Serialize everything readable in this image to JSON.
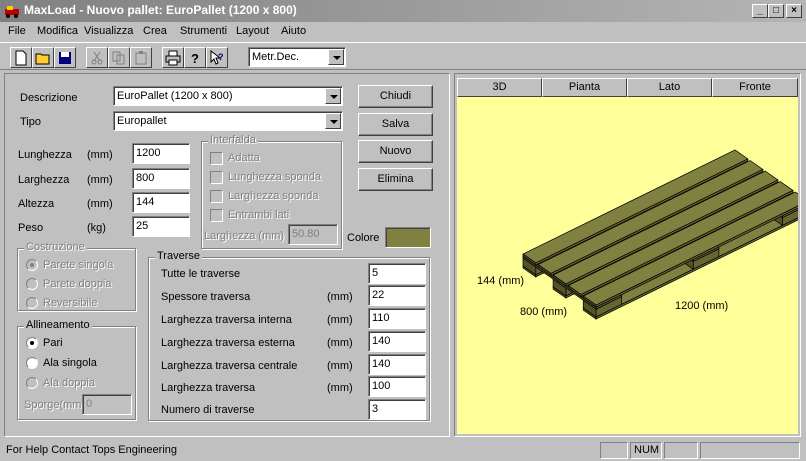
{
  "window": {
    "title": "MaxLoad - Nuovo pallet: EuroPallet (1200 x 800)"
  },
  "menu": [
    "File",
    "Modifica",
    "Visualizza",
    "Crea",
    "Strumenti",
    "Layout",
    "Aiuto"
  ],
  "toolbar": {
    "units": "Metr.Dec."
  },
  "form": {
    "descrizione_label": "Descrizione",
    "descrizione_value": "EuroPallet (1200 x 800)",
    "tipo_label": "Tipo",
    "tipo_value": "Europallet",
    "lunghezza_label": "Lunghezza",
    "lunghezza_unit": "(mm)",
    "lunghezza_value": "1200",
    "larghezza_label": "Larghezza",
    "larghezza_unit": "(mm)",
    "larghezza_value": "800",
    "altezza_label": "Altezza",
    "altezza_unit": "(mm)",
    "altezza_value": "144",
    "peso_label": "Peso",
    "peso_unit": "(kg)",
    "peso_value": "25",
    "colore_label": "Colore",
    "colore_hex": "#808040"
  },
  "buttons": {
    "chiudi": "Chiudi",
    "salva": "Salva",
    "nuovo": "Nuovo",
    "elimina": "Elimina"
  },
  "interfalda": {
    "title": "Interfalda",
    "adatta": "Adatta",
    "lunghezza_sponda": "Lunghezza sponda",
    "larghezza_sponda": "Larghezza sponda",
    "entrambi_lati": "Entrambi lati",
    "larghezza_label": "Larghezza (mm)",
    "larghezza_value": "50.80"
  },
  "costruzione": {
    "title": "Costruzione",
    "parete_singola": "Parete singola",
    "parete_doppia": "Parete doppia",
    "reversibile": "Reversibile"
  },
  "allineamento": {
    "title": "Allineamento",
    "pari": "Pari",
    "ala_singola": "Ala singola",
    "ala_doppia": "Ala doppia",
    "sporge_label": "Sporge(mm)",
    "sporge_value": "0"
  },
  "traverse": {
    "title": "Traverse",
    "rows": [
      {
        "label": "Tutte le traverse",
        "unit": "",
        "value": "5"
      },
      {
        "label": "Spessore traversa",
        "unit": "(mm)",
        "value": "22"
      },
      {
        "label": "Larghezza traversa interna",
        "unit": "(mm)",
        "value": "110"
      },
      {
        "label": "Larghezza traversa esterna",
        "unit": "(mm)",
        "value": "140"
      },
      {
        "label": "Larghezza traversa centrale",
        "unit": "(mm)",
        "value": "140"
      },
      {
        "label": "Larghezza traversa",
        "unit": "(mm)",
        "value": "100"
      },
      {
        "label": "Numero di traverse",
        "unit": "",
        "value": "3"
      }
    ]
  },
  "view_tabs": [
    "3D",
    "Pianta",
    "Lato",
    "Fronte"
  ],
  "view": {
    "height_label": "144 (mm)",
    "width_label": "800 (mm)",
    "length_label": "1200 (mm)",
    "background": "#ffff99",
    "pallet_color": "#808040"
  },
  "status": {
    "text": "For Help Contact Tops Engineering",
    "num": "NUM"
  }
}
